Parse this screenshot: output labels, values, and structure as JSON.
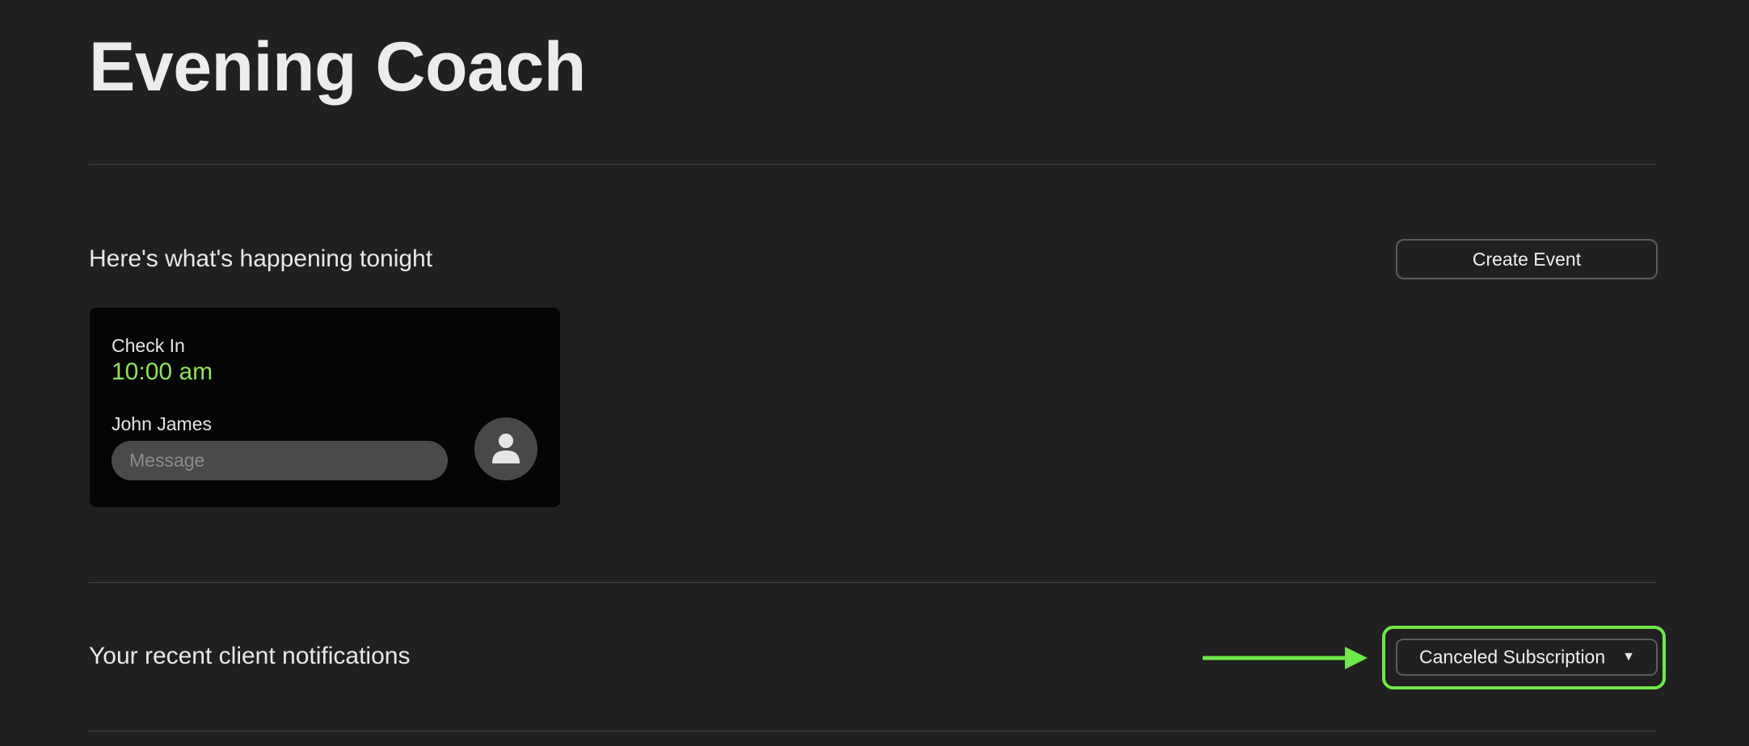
{
  "header": {
    "title": "Evening Coach"
  },
  "tonight": {
    "heading": "Here's what's happening tonight",
    "create_event_label": "Create Event",
    "events": [
      {
        "type": "Check In",
        "time": "10:00 am",
        "client_name": "John James",
        "message_placeholder": "Message"
      }
    ]
  },
  "notifications": {
    "heading": "Your recent client notifications",
    "filter_selected": "Canceled Subscription"
  },
  "colors": {
    "background": "#202020",
    "card_background": "#050505",
    "accent_green": "#8fe35a",
    "highlight_green": "#6fe84a"
  },
  "icons": {
    "avatar": "user-icon",
    "dropdown": "chevron-down-icon",
    "annotation": "arrow-right-icon"
  }
}
